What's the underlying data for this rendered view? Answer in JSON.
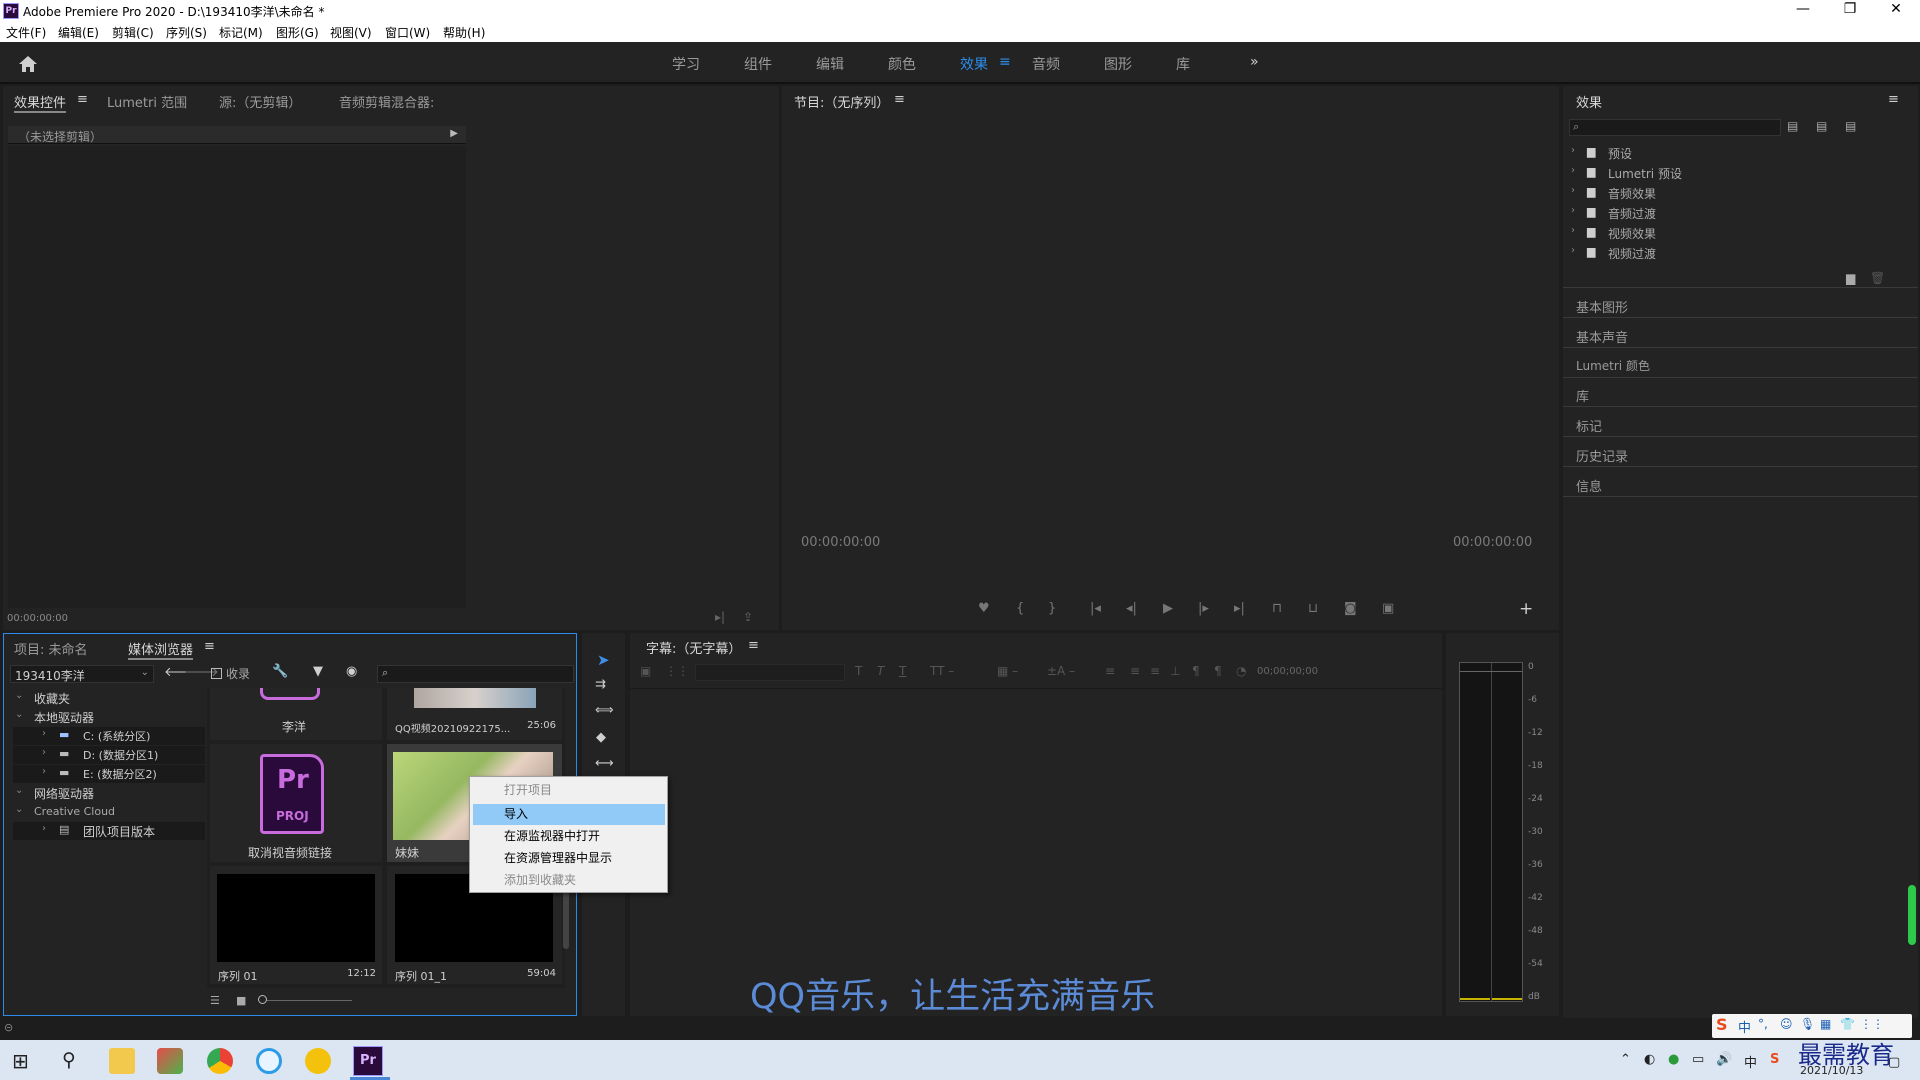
{
  "window": {
    "title": "Adobe Premiere Pro 2020 - D:\\193410李洋\\未命名 *",
    "logo": "Pr"
  },
  "menu": [
    "文件(F)",
    "编辑(E)",
    "剪辑(C)",
    "序列(S)",
    "标记(M)",
    "图形(G)",
    "视图(V)",
    "窗口(W)",
    "帮助(H)"
  ],
  "workspaces": [
    "学习",
    "组件",
    "编辑",
    "颜色",
    "效果",
    "音频",
    "图形",
    "库"
  ],
  "active_workspace": "效果",
  "source_panel": {
    "tabs": [
      "效果控件",
      "Lumetri 范围",
      "源:（无剪辑）",
      "音频剪辑混合器:"
    ],
    "no_clip": "（未选择剪辑）",
    "timecode": "00:00:00:00"
  },
  "program_panel": {
    "title": "节目:（无序列）",
    "tc_left": "00:00:00:00",
    "tc_right": "00:00:00:00"
  },
  "effects_panel": {
    "title": "效果",
    "items": [
      "预设",
      "Lumetri 预设",
      "音频效果",
      "音频过渡",
      "视频效果",
      "视频过渡"
    ],
    "sections": [
      "基本图形",
      "基本声音",
      "Lumetri 颜色",
      "库",
      "标记",
      "历史记录",
      "信息"
    ]
  },
  "project_panel": {
    "tabs": [
      "项目: 未命名",
      "媒体浏览器"
    ],
    "location": "193410李洋",
    "favorites_checkbox": "收录",
    "tree": [
      {
        "label": "收藏夹",
        "level": 0
      },
      {
        "label": "本地驱动器",
        "level": 0
      },
      {
        "label": "C: (系统分区)",
        "level": 1
      },
      {
        "label": "D: (数据分区1)",
        "level": 1
      },
      {
        "label": "E: (数据分区2)",
        "level": 1
      },
      {
        "label": "网络驱动器",
        "level": 0
      },
      {
        "label": "Creative Cloud",
        "level": 0
      },
      {
        "label": "团队项目版本",
        "level": 1
      }
    ],
    "thumbnails": [
      {
        "name": "李洋",
        "duration": ""
      },
      {
        "name": "QQ视频20210922175...",
        "duration": "25:06"
      },
      {
        "name": "取消视音频链接",
        "duration": ""
      },
      {
        "name": "妹妹",
        "duration": ""
      },
      {
        "name": "序列 01",
        "duration": "12:12"
      },
      {
        "name": "序列 01_1",
        "duration": "59:04"
      }
    ],
    "proj_label": "PROJ"
  },
  "captions_panel": {
    "title": "字幕:（无字幕）",
    "timecode": "00;00;00;00"
  },
  "audio_meter": {
    "ticks": [
      "0",
      "-6",
      "-12",
      "-18",
      "-24",
      "-30",
      "-36",
      "-42",
      "-48",
      "-54",
      "dB"
    ]
  },
  "context_menu": {
    "items": [
      "打开项目",
      "导入",
      "在源监视器中打开",
      "在资源管理器中显示",
      "添加到收藏夹"
    ],
    "highlighted": 1,
    "disabled": [
      0,
      4
    ]
  },
  "subtitle_overlay": "QQ音乐，让生活充满音乐",
  "taskbar": {
    "date": "2021/10/13",
    "ime": "中",
    "watermark": "最需教育"
  },
  "colors": {
    "accent": "#2d8ceb",
    "panel": "#232323",
    "bg": "#1d1d1d",
    "highlight": "#91c9f7",
    "pr_purple": "#c86bdc"
  }
}
